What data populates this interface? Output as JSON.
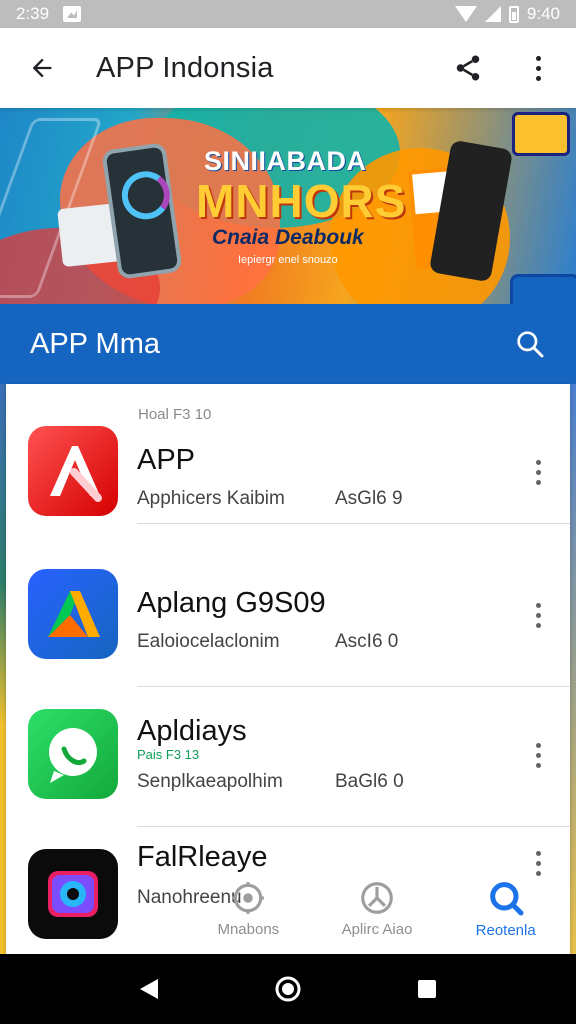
{
  "status_bar": {
    "time_left": "2:39",
    "time_right": "9:40"
  },
  "app_bar": {
    "title": "APP Indonsia",
    "back_icon": "arrow-back-icon",
    "share_icon": "share-icon",
    "more_icon": "more-vert-icon"
  },
  "banner": {
    "headline": "SINIIABADA",
    "brand": "MNHORS",
    "tagline": "Cnaia Deabouk",
    "subtag": "Iepiergr enel snouzo"
  },
  "section": {
    "title": "APP Mma",
    "search_icon": "search-icon"
  },
  "list": {
    "caption": "Hoal F3 10",
    "items": [
      {
        "name": "APP",
        "description": "Apphicers Kaibim",
        "size": "AsGl6 9",
        "extra_label": ""
      },
      {
        "name": "Aplang G9S09",
        "description": "Ealoiocelaclonim",
        "size": "AscI6 0",
        "extra_label": ""
      },
      {
        "name": "Apldiays",
        "description": "Senplkaeapolhim",
        "size": "BaGl6 0",
        "extra_label": "Pais F3 13"
      },
      {
        "name": "FalRleaye",
        "description": "Nanohreenu",
        "size": "",
        "extra_label": ""
      }
    ]
  },
  "bottom_nav": {
    "items": [
      {
        "label": "Mnabons",
        "icon": "settings-icon",
        "active": false
      },
      {
        "label": "Aplirc Aiao",
        "icon": "apps-icon",
        "active": false
      },
      {
        "label": "Reotenla",
        "icon": "search-icon",
        "active": true
      }
    ]
  },
  "system_nav": {
    "back": "back-triangle-icon",
    "home": "home-circle-icon",
    "recents": "recents-square-icon"
  },
  "colors": {
    "primary": "#1565c0",
    "accent": "#1a73e8",
    "banner_orange": "#f07b22",
    "icon_red": "#e53935",
    "icon_blue": "#1e5bd8",
    "icon_green": "#22b94a"
  }
}
